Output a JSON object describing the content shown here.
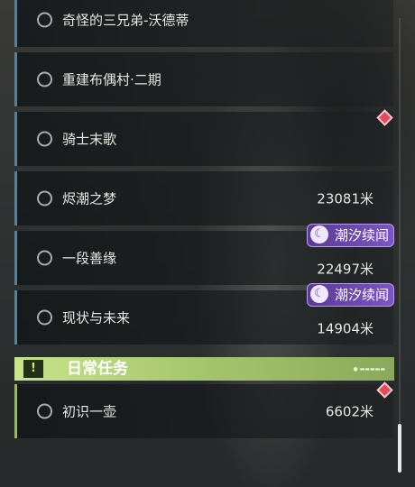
{
  "quests": [
    {
      "name": "奇怪的三兄弟-沃德蒂",
      "distance": "",
      "tag": ""
    },
    {
      "name": "重建布偶村·二期",
      "distance": "",
      "tag": ""
    },
    {
      "name": "骑士末歌",
      "distance": "",
      "tag": ""
    },
    {
      "name": "烬潮之梦",
      "distance": "23081米",
      "tag": ""
    },
    {
      "name": "一段善缘",
      "distance": "22497米",
      "tag": "潮汐续闻"
    },
    {
      "name": "现状与未来",
      "distance": "14904米",
      "tag": "潮汐续闻"
    }
  ],
  "daily_section": {
    "title": "日常任务",
    "icon": "!",
    "quests": [
      {
        "name": "初识一壶",
        "distance": "6602米"
      }
    ]
  },
  "colors": {
    "quest_border": "#5f7e90",
    "daily_accent": "#c8e48c",
    "tag_purple": "#6a44b0",
    "marker_red": "#e04a5a"
  }
}
